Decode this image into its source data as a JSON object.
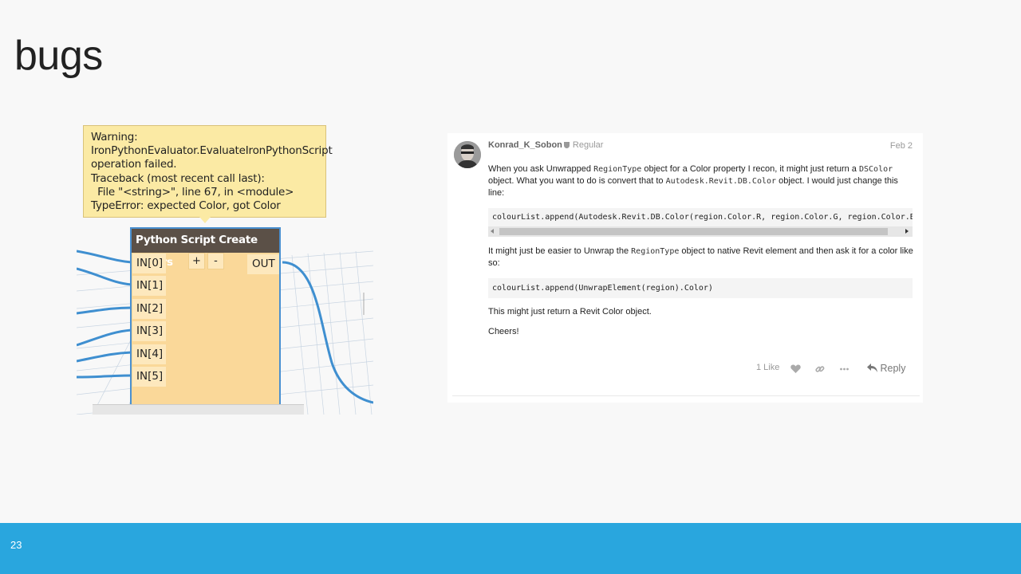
{
  "slide": {
    "title": "bugs",
    "page_number": "23"
  },
  "dynamo": {
    "warning": "Warning:\nIronPythonEvaluator.EvaluateIronPythonScript\noperation failed.\nTraceback (most recent call last):\n  File \"<string>\", line 67, in <module>\nTypeError: expected Color, got Color",
    "node_title": "Python Script Create Filters",
    "inputs": [
      "IN[0]",
      "IN[1]",
      "IN[2]",
      "IN[3]",
      "IN[4]",
      "IN[5]"
    ],
    "add_label": "+",
    "remove_label": "-",
    "output": "OUT"
  },
  "forum": {
    "author": "Konrad_K_Sobon",
    "user_title": "Regular",
    "date": "Feb 2",
    "para1": {
      "t1": "When you ask Unwrapped ",
      "c1": "RegionType",
      "t2": " object for a Color property I recon, it might just return a ",
      "c2": "DSColor",
      "t3": " object. What you want to do is convert that to ",
      "c3": "Autodesk.Revit.DB.Color",
      "t4": " object. I would just change this line:"
    },
    "code1": "colourList.append(Autodesk.Revit.DB.Color(region.Color.R, region.Color.G, region.Color.B,",
    "para2": {
      "t1": "It might just be easier to Unwrap the ",
      "c1": "RegionType",
      "t2": " object to native Revit element and then ask it for a color like so:"
    },
    "code2": "colourList.append(UnwrapElement(region).Color)",
    "para3": "This might just return a Revit Color object.",
    "para4": "Cheers!",
    "likes": "1 Like",
    "reply": "Reply",
    "icons": [
      "heart-icon",
      "link-icon",
      "more-icon",
      "reply-icon",
      "shield-icon"
    ]
  },
  "colors": {
    "footer": "#29a6de",
    "node_body": "#fad899",
    "node_header": "#5b5047",
    "wire": "#3f8fd0",
    "warning_bg": "#fbeaa4"
  }
}
